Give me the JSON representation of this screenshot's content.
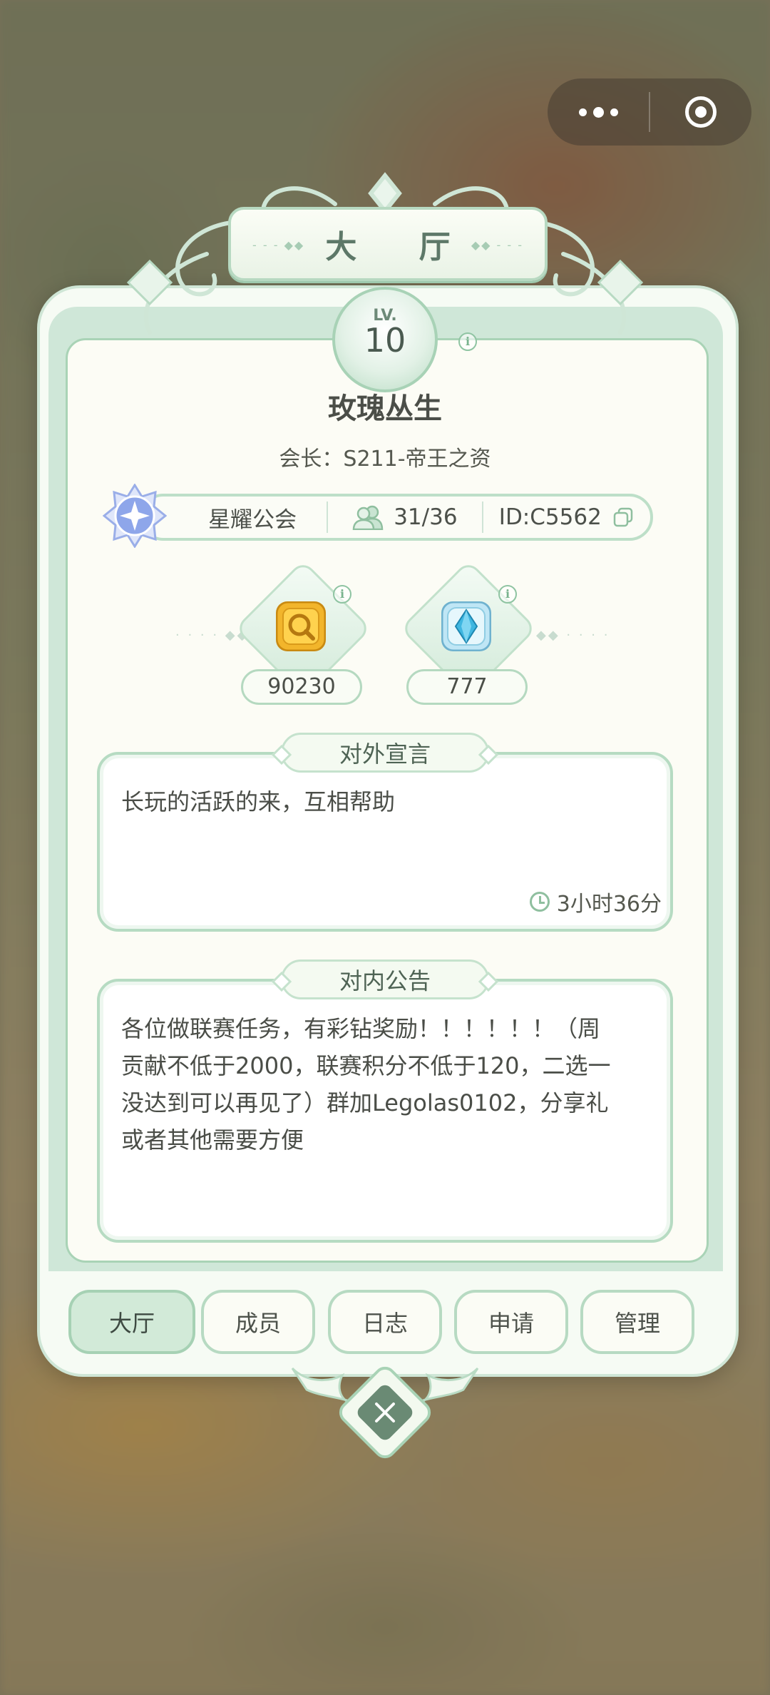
{
  "capsule": {
    "more_icon": "more-dots-icon",
    "close_icon": "target-circle-icon"
  },
  "header": {
    "title": "大 厅"
  },
  "guild": {
    "level_prefix": "LV.",
    "level": "10",
    "name": "玫瑰丛生",
    "leader": "会长：S211-帝王之资",
    "rank": "星耀公会",
    "members": "31/36",
    "id": "ID:C5562"
  },
  "currencies": [
    {
      "icon": "gold-coin-icon",
      "value": "90230"
    },
    {
      "icon": "blue-crystal-icon",
      "value": "777"
    }
  ],
  "external": {
    "title": "对外宣言",
    "text": "长玩的活跃的来，互相帮助",
    "time": "3小时36分"
  },
  "internal": {
    "title": "对内公告",
    "lines": [
      "各位做联赛任务，有彩钻奖励！！！！！！（周",
      "贡献不低于2000，联赛积分不低于120，二选一",
      "没达到可以再见了）群加Legolas0102，分享礼",
      "或者其他需要方便"
    ]
  },
  "tabs": [
    "大厅",
    "成员",
    "日志",
    "申请",
    "管理"
  ],
  "colors": {
    "accent": "#a9d3b6",
    "panel": "#fcfcf5",
    "active_tab": "#d2ead8"
  }
}
